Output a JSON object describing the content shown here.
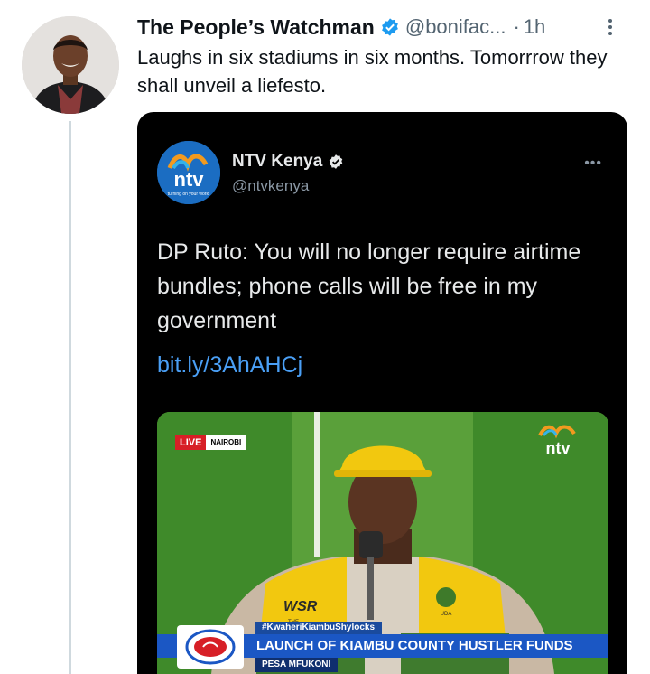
{
  "tweet": {
    "display_name": "The People’s Watchman",
    "handle": "@bonifac...",
    "separator": "·",
    "time": "1h",
    "text": "Laughs in six stadiums in six months. Tomorrrow they shall unveil a liefesto."
  },
  "quoted": {
    "name": "NTV Kenya",
    "handle": "@ntvkenya",
    "more": "•••",
    "text": "DP Ruto: You will no longer require airtime bundles; phone calls will be free in my government",
    "link": "bit.ly/3AhAHCj",
    "logo_text": "ntv",
    "logo_tagline": "turning on your world"
  },
  "video": {
    "live_label": "LIVE",
    "location_label": "NAIROBI",
    "logo_text": "ntv",
    "hashtag": "#KwaheriKiambuShylocks",
    "headline": "LAUNCH OF KIAMBU COUNTY HUSTLER FUNDS",
    "subline": "PESA MFUKONI",
    "vest_text": "WSR",
    "vest_sub": "THE",
    "party_text": "UDA"
  },
  "colors": {
    "verified_blue": "#1d9bf0",
    "link_blue": "#4a9ff5",
    "live_red": "#d71f26",
    "vest_yellow": "#f2c80f"
  },
  "icons": {
    "verified": "verified-badge-icon",
    "more": "kebab-menu-icon"
  }
}
